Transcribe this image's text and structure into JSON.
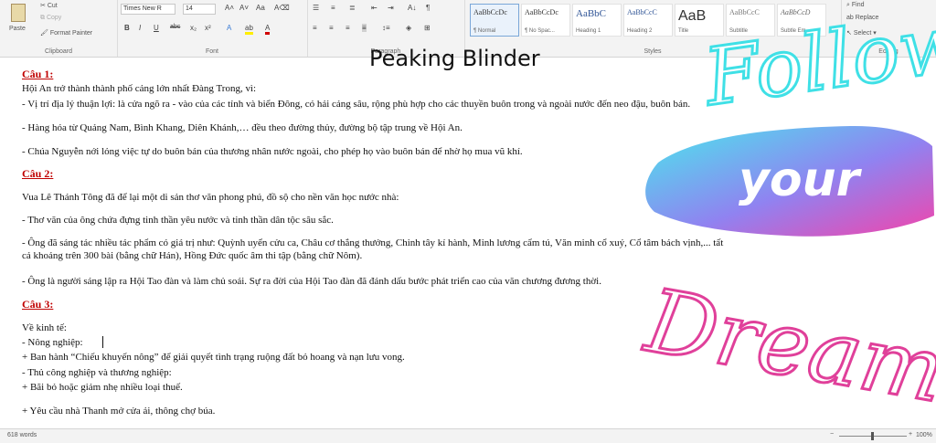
{
  "ribbon": {
    "clipboard": {
      "paste": "Paste",
      "cut": "Cut",
      "copy": "Copy",
      "format_painter": "Format Painter",
      "label": "Clipboard"
    },
    "font": {
      "family": "Times New R",
      "size": "14",
      "bold": "B",
      "italic": "I",
      "underline": "U",
      "strike": "abc",
      "sub": "x₂",
      "sup": "x²",
      "label": "Font"
    },
    "paragraph": {
      "label": "Paragraph"
    },
    "styles": {
      "label": "Styles",
      "items": [
        {
          "preview": "AaBbCcDc",
          "name": "¶ Normal"
        },
        {
          "preview": "AaBbCcDc",
          "name": "¶ No Spac..."
        },
        {
          "preview": "AaBbC",
          "name": "Heading 1"
        },
        {
          "preview": "AaBbCcC",
          "name": "Heading 2"
        },
        {
          "preview": "AaB",
          "name": "Title"
        },
        {
          "preview": "AaBbCcC",
          "name": "Subtitle"
        },
        {
          "preview": "AaBbCcD",
          "name": "Subtle Em..."
        }
      ]
    },
    "editing": {
      "find": "Find",
      "replace": "Replace",
      "select": "Select",
      "label": "Editing"
    }
  },
  "document": {
    "title": "Peaking Blinder",
    "q1": "Câu 1:",
    "l1": "Hội An trở thành thành phố cảng lớn nhất Đàng Trong, vì:",
    "l2": "- Vị trí địa lý thuận lợi: là cửa ngõ ra - vào của các tỉnh và biển Đông, có hải cảng sâu, rộng phù hợp cho các thuyền buôn trong và ngoài nước đến neo đậu, buôn bán.",
    "l3": "- Hàng hóa từ Quảng Nam, Bình Khang, Diên Khánh,… đều theo đường thủy, đường bộ tập trung về Hội An.",
    "l4": "- Chúa Nguyễn nới lỏng việc tự do buôn bán của thương nhân nước ngoài, cho phép họ vào buôn bán để nhờ họ mua vũ khí.",
    "q2": "Câu 2:",
    "l5": "Vua Lê Thánh Tông đã để lại một di sản thơ văn phong phú, đồ sộ cho nền văn học nước nhà:",
    "l6": "- Thơ văn của ông chứa đựng tinh thần yêu nước và tinh thần dân tộc sâu sắc.",
    "l7": "- Ông đã sáng tác nhiều tác phẩm có giá trị như: Quỳnh uyển cửu ca, Châu cơ thắng thưởng, Chinh tây kí hành, Minh lương cẩm tú, Văn minh cổ xuý, Cổ tâm bách vịnh,... tất",
    "l8": "cả khoảng trên 300 bài (bằng chữ Hán), Hồng Đức quốc âm thi tập (bằng chữ Nôm).",
    "l9": "- Ông là người sáng lập ra Hội Tao đàn và làm chủ soái. Sự ra đời của Hội Tao đàn đã đánh dấu bước phát triển cao của văn chương đương thời.",
    "q3": "Câu 3:",
    "l10": "Về kinh tế:",
    "l11": "- Nông nghiệp:",
    "l12": "+ Ban hành “Chiếu khuyến nông” để giải quyết tình trạng ruộng đất bỏ hoang và nạn lưu vong.",
    "l13": "- Thủ công nghiệp và thương nghiệp:",
    "l14": "+ Bãi bỏ hoặc giảm nhẹ nhiều loại thuế.",
    "l15": "+ Yêu cầu nhà Thanh mở cửa ải, thông chợ búa."
  },
  "overlay": {
    "follow": "Follow",
    "your": "your",
    "dreams": "Dreams"
  },
  "status": {
    "words": "618 words",
    "zoom": "100%"
  },
  "colors": {
    "heading_red": "#c00000",
    "cyan": "#3fe0e6",
    "pink": "#e0409a"
  }
}
